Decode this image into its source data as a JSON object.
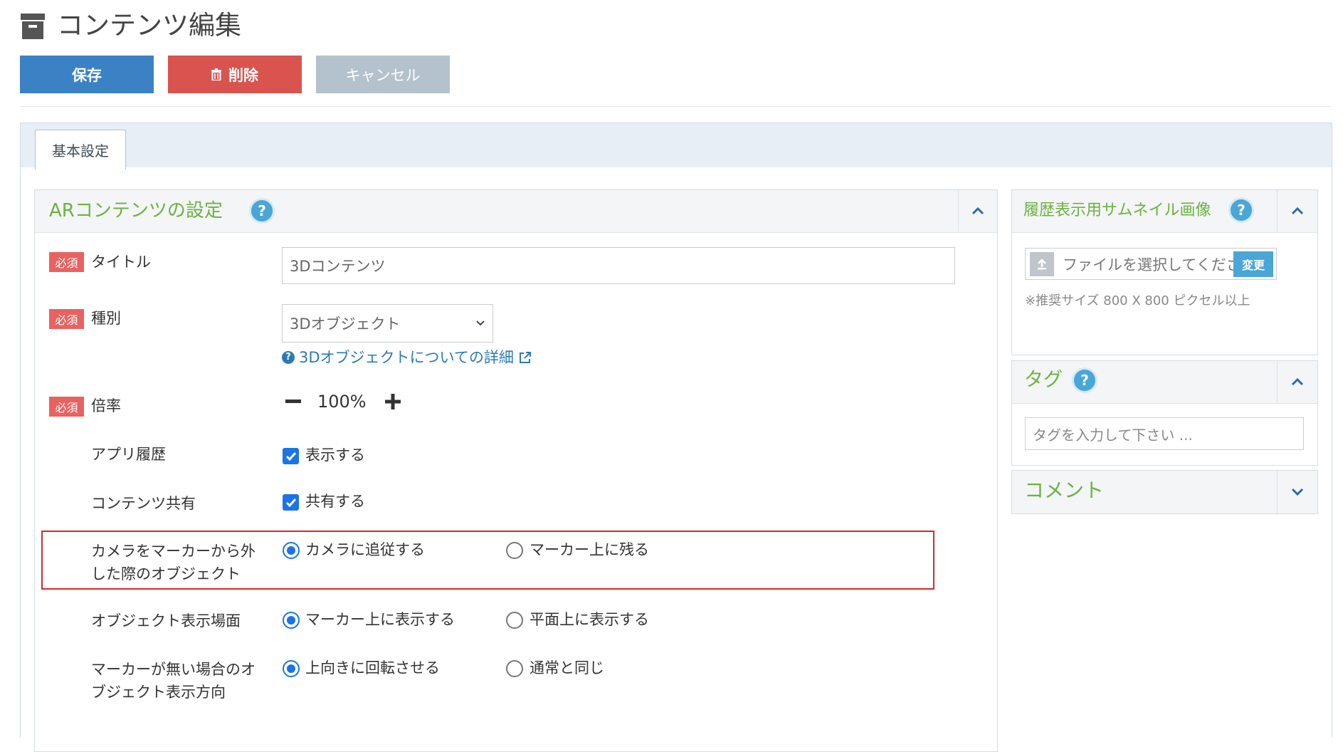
{
  "header": {
    "title": "コンテンツ編集",
    "save_label": "保存",
    "delete_label": "削除",
    "cancel_label": "キャンセル"
  },
  "tabs": [
    {
      "label": "基本設定",
      "active": true
    }
  ],
  "ar_settings": {
    "title": "ARコンテンツの設定",
    "required_badge": "必須",
    "fields": {
      "title": {
        "label": "タイトル",
        "value": "3Dコンテンツ"
      },
      "type": {
        "label": "種別",
        "selected": "3Dオブジェクト",
        "detail_link": "3Dオブジェクトについての詳細"
      },
      "scale": {
        "label": "倍率",
        "value": "100%"
      },
      "app_history": {
        "label": "アプリ履歴",
        "option": "表示する",
        "checked": true
      },
      "content_share": {
        "label": "コンテンツ共有",
        "option": "共有する",
        "checked": true
      },
      "camera_off_marker": {
        "label_line1": "カメラをマーカーから外",
        "label_line2": "した際のオブジェクト",
        "options": [
          "カメラに追従する",
          "マーカー上に残る"
        ],
        "selected": 0
      },
      "display_surface": {
        "label": "オブジェクト表示場面",
        "options": [
          "マーカー上に表示する",
          "平面上に表示する"
        ],
        "selected": 0
      },
      "no_marker_direction": {
        "label_line1": "マーカーが無い場合のオ",
        "label_line2": "ブジェクト表示方向",
        "options": [
          "上向きに回転させる",
          "通常と同じ"
        ],
        "selected": 0
      }
    }
  },
  "thumbnail": {
    "title": "履歴表示用サムネイル画像",
    "file_placeholder": "ファイルを選択してくださ",
    "change_label": "変更",
    "hint": "※推奨サイズ 800 X 800 ピクセル以上"
  },
  "tags": {
    "title": "タグ",
    "placeholder": "タグを入力して下さい ..."
  },
  "comment": {
    "title": "コメント"
  },
  "colors": {
    "primary": "#3b82c5",
    "danger": "#d9534f",
    "disabled": "#b4c2cd",
    "accent_green": "#6cb33f",
    "required_red": "#e8625f",
    "help_blue": "#4aa6d6",
    "highlight_red": "#d42a2a"
  }
}
